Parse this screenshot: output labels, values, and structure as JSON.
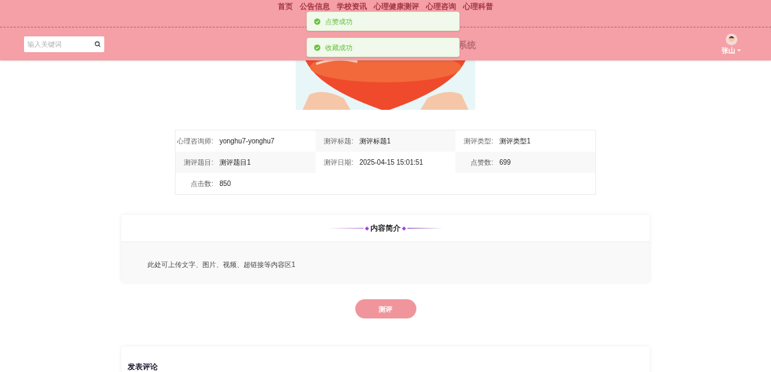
{
  "nav": [
    {
      "label": "首页"
    },
    {
      "label": "公告信息"
    },
    {
      "label": "学校资讯"
    },
    {
      "label": "心理健康测评"
    },
    {
      "label": "心理咨询"
    },
    {
      "label": "心理科普"
    }
  ],
  "toasts": [
    {
      "text": "点赞成功"
    },
    {
      "text": "收藏成功"
    }
  ],
  "header": {
    "search": {
      "placeholder": "输入关键词"
    },
    "title": "系统",
    "user": "张山"
  },
  "details": [
    {
      "label": "心理咨询师:",
      "value": "yonghu7-yonghu7"
    },
    {
      "label": "测评标题:",
      "value": "测评标题1"
    },
    {
      "label": "测评类型:",
      "value": "测评类型1"
    },
    {
      "label": "测评题目:",
      "value": "测评题目1"
    },
    {
      "label": "测评日期:",
      "value": "2025-04-15 15:01:51"
    },
    {
      "label": "点赞数:",
      "value": "699"
    },
    {
      "label": "点击数:",
      "value": "850"
    }
  ],
  "intro": {
    "title": "内容简介",
    "text": "此处可上传文字、图片、视频、超链接等内容区1"
  },
  "action_button": "测评",
  "comments": {
    "title": "发表评论"
  }
}
